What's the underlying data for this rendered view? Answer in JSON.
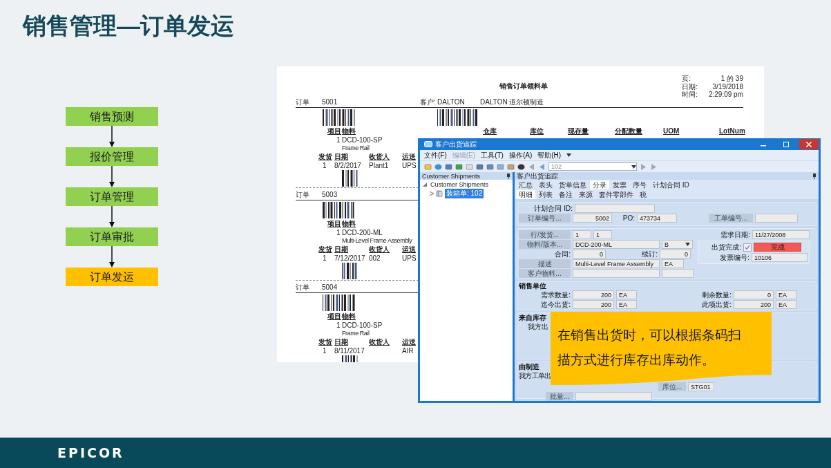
{
  "title": "销售管理—订单发运",
  "flow": [
    {
      "label": "销售预测",
      "selected": false
    },
    {
      "label": "报价管理",
      "selected": false
    },
    {
      "label": "订单管理",
      "selected": false
    },
    {
      "label": "订单审批",
      "selected": false
    },
    {
      "label": "订单发运",
      "selected": true
    }
  ],
  "report": {
    "heading": "销售订单领料单",
    "meta": [
      {
        "label": "页:",
        "value": "1 的 39"
      },
      {
        "label": "日期:",
        "value": "3/19/2018"
      },
      {
        "label": "时间:",
        "value": "2:29:09 pm"
      }
    ],
    "orders": [
      {
        "label": "订单",
        "number": "5001",
        "customer_label": "客户:",
        "customer": "DALTON",
        "customer_name": "DALTON 道尔顿制造",
        "item_headers": [
          "项目",
          "物料"
        ],
        "stock_headers": [
          "仓库",
          "库位",
          "现存量",
          "分配数量",
          "UOM",
          "LotNum"
        ],
        "line": "1",
        "part": "DCD-100-SP",
        "description": "Frame Rail",
        "ship_headers": [
          "发货",
          "日期",
          "收货人",
          "运送"
        ],
        "ship": {
          "number": "1",
          "date": "8/2/2017",
          "receiver": "Plant1",
          "carrier": "UPS"
        }
      },
      {
        "label": "订单",
        "number": "5003",
        "item_headers": [
          "项目",
          "物料"
        ],
        "line": "1",
        "part": "DCD-200-ML",
        "description": "Multi-Level Frame Assembly",
        "ship_headers": [
          "发货",
          "日期",
          "收货人",
          "运送"
        ],
        "ship": {
          "number": "1",
          "date": "7/12/2017",
          "receiver": "002",
          "carrier": "UPS"
        }
      },
      {
        "label": "订单",
        "number": "5004",
        "item_headers": [
          "项目",
          "物料"
        ],
        "line": "1",
        "part": "DCD-100-SP",
        "description": "Frame Rail",
        "ship_headers": [
          "发货",
          "日期",
          "收货人",
          "运送"
        ],
        "ship": {
          "number": "1",
          "date": "8/11/2017",
          "carrier": "AIR"
        }
      }
    ]
  },
  "app_window": {
    "title": "客户出货追踪",
    "menu": [
      {
        "label": "文件(F)",
        "disabled": false
      },
      {
        "label": "编辑(E)",
        "disabled": true
      },
      {
        "label": "工具(T)",
        "disabled": false
      },
      {
        "label": "操作(A)",
        "disabled": false
      },
      {
        "label": "帮助(H)",
        "disabled": false
      }
    ],
    "toolbar": {
      "record": "102"
    },
    "left_pane": {
      "header": "Customer Shipments",
      "tree": [
        {
          "label": "Customer Shipments",
          "expanded": true,
          "selected": false,
          "children": [
            {
              "label": "装箱单: 102",
              "expanded": false,
              "selected": true
            }
          ]
        }
      ]
    },
    "right_pane": {
      "header": "客户出货追踪",
      "tabs": [
        {
          "label": "汇总",
          "selected": false
        },
        {
          "label": "表头",
          "selected": false
        },
        {
          "label": "货单信息",
          "selected": false
        },
        {
          "label": "分录",
          "selected": true
        },
        {
          "label": "发票",
          "selected": false
        },
        {
          "label": "序号",
          "selected": false
        },
        {
          "label": "计划合同 ID",
          "selected": false
        }
      ],
      "subtabs": [
        {
          "label": "明细",
          "selected": true
        },
        {
          "label": "列表",
          "selected": false
        },
        {
          "label": "备注",
          "selected": false
        },
        {
          "label": "来源",
          "selected": false
        },
        {
          "label": "套件零部件",
          "selected": false
        },
        {
          "label": "税",
          "selected": false
        }
      ],
      "form": {
        "plan_contract": {
          "label": "计划合同 ID:"
        },
        "order_number": {
          "button": "订单编号...",
          "value": "5002"
        },
        "po": {
          "label": "PO:",
          "value": "473734"
        },
        "job_number": {
          "button": "工单编号..."
        },
        "line_release": {
          "button": "行/发货...",
          "line": "1",
          "release": "1"
        },
        "need_date": {
          "label": "需求日期:",
          "value": "11/27/2008"
        },
        "part_rev": {
          "button": "物料/版本...",
          "part": "DCD-200-ML",
          "revision": "B"
        },
        "ship_complete": {
          "label": "出货完成:",
          "checked": true,
          "status": "完成"
        },
        "contract": {
          "label": "合同:",
          "value": "0"
        },
        "renewal": {
          "label": "续订:",
          "value": "0"
        },
        "invoice": {
          "label": "发票编号:",
          "value": "10106"
        },
        "description": {
          "button": "描述",
          "value": "Multi-Level Frame Assembly",
          "uom": "EA"
        },
        "customer_part": {
          "button": "客户物料..."
        },
        "sales_unit": {
          "header": "销售单位",
          "fields": [
            {
              "label": "需求数量:",
              "value": "200",
              "uom": "EA"
            },
            {
              "label": "剩余数量:",
              "value": "0",
              "uom": "EA"
            },
            {
              "label": "迄今出货:",
              "value": "200",
              "uom": "EA"
            },
            {
              "label": "此项出货:",
              "value": "200",
              "uom": "EA"
            }
          ]
        },
        "from_stock": {
          "header": "来自库存",
          "label": "我方出"
        },
        "from_mfg": {
          "header": "由制造",
          "label": "我方工单出",
          "bin_button": "库位...",
          "bin": "STG01",
          "lot_button": "批量..."
        }
      }
    }
  },
  "callout": {
    "text": "在销售出货时，可以根据条码扫描方式进行库存出库动作。"
  },
  "footer": {
    "logo": "EPICOR"
  }
}
